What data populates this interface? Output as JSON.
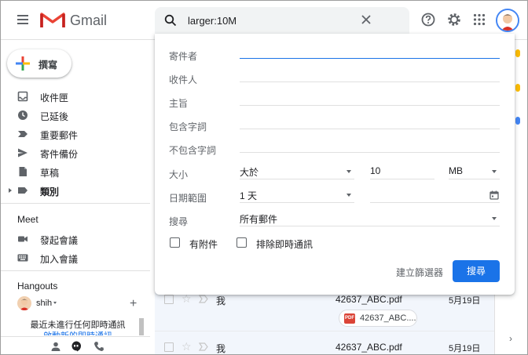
{
  "header": {
    "app_name": "Gmail",
    "search_query": "larger:10M"
  },
  "sidebar": {
    "compose_label": "撰寫",
    "items": [
      {
        "label": "收件匣"
      },
      {
        "label": "已延後"
      },
      {
        "label": "重要郵件"
      },
      {
        "label": "寄件備份"
      },
      {
        "label": "草稿"
      },
      {
        "label": "類別"
      }
    ],
    "meet": {
      "title": "Meet",
      "items": [
        {
          "label": "發起會議"
        },
        {
          "label": "加入會議"
        }
      ]
    },
    "hangouts": {
      "title": "Hangouts",
      "user": "shih",
      "empty_text": "最近未進行任何即時通訊",
      "link_text": "啟動新的即時通訊"
    }
  },
  "search_panel": {
    "from_label": "寄件者",
    "to_label": "收件人",
    "subject_label": "主旨",
    "has_words_label": "包含字詞",
    "not_words_label": "不包含字詞",
    "size_label": "大小",
    "size_operator": "大於",
    "size_value": "10",
    "size_unit": "MB",
    "date_label": "日期範圍",
    "date_range": "1 天",
    "search_in_label": "搜尋",
    "search_in": "所有郵件",
    "has_attachment_label": "有附件",
    "exclude_chats_label": "排除即時通訊",
    "create_filter_label": "建立篩選器",
    "search_button_label": "搜尋"
  },
  "emails": [
    {
      "sender": "我",
      "subject": "42637_ABC.pdf",
      "date": "5月19日",
      "attachment": "42637_ABC...."
    },
    {
      "sender": "我",
      "subject": "42637_ABC.pdf",
      "date": "5月19日"
    }
  ],
  "colors": {
    "accent": "#1a73e8",
    "gmail_red": "#ea4335",
    "row_bg": "#f2f6fc"
  }
}
